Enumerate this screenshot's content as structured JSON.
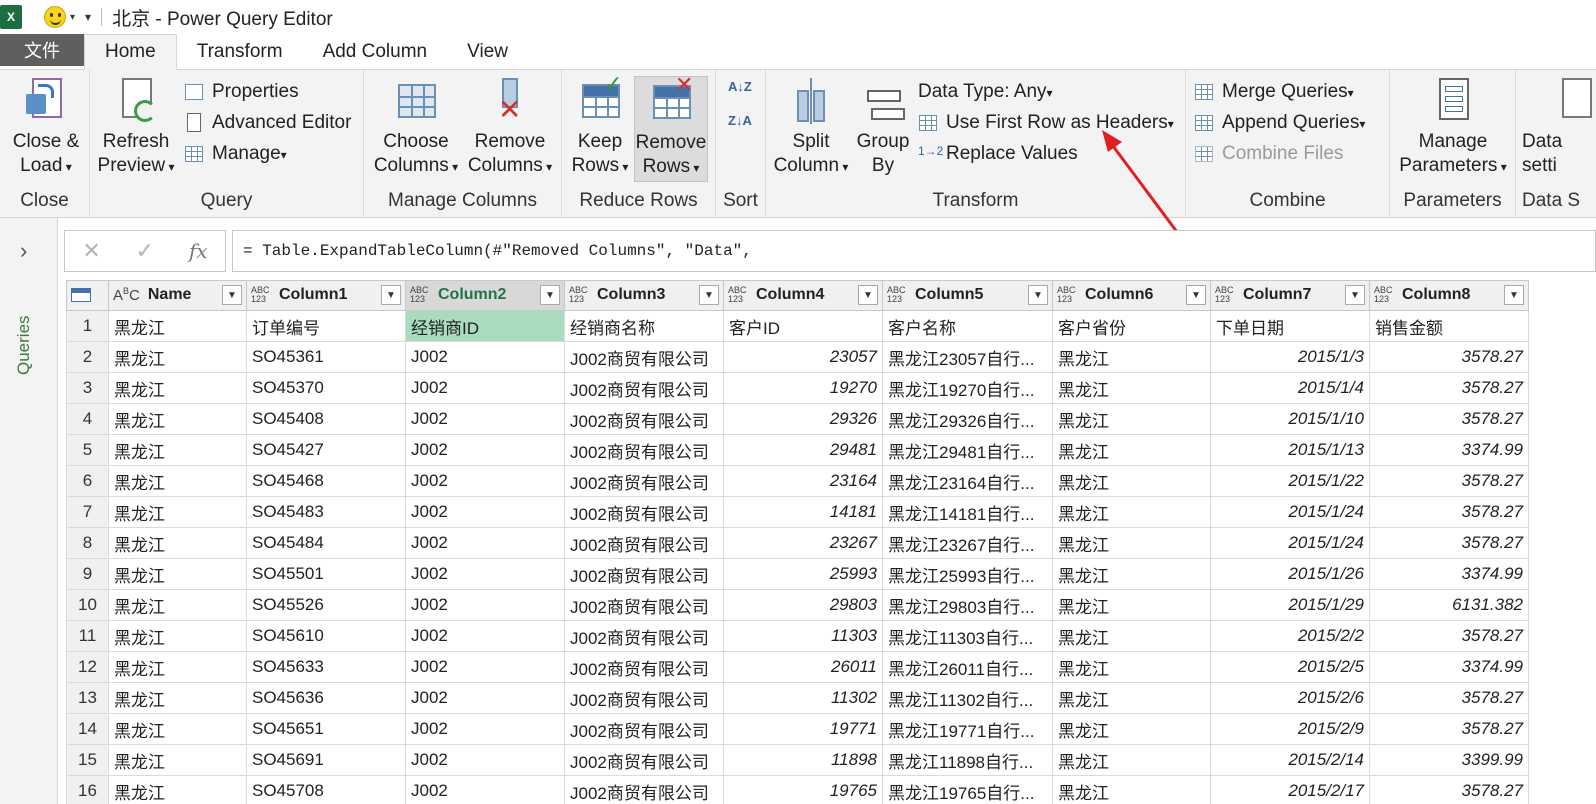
{
  "window": {
    "title": "北京 - Power Query Editor",
    "app_icon": "X"
  },
  "tabs": {
    "file": "文件",
    "items": [
      "Home",
      "Transform",
      "Add Column",
      "View"
    ],
    "active": "Home"
  },
  "ribbon": {
    "close": {
      "close_load_line1": "Close &",
      "close_load_line2": "Load",
      "label": "Close"
    },
    "query": {
      "refresh_line1": "Refresh",
      "refresh_line2": "Preview",
      "properties": "Properties",
      "advanced_editor": "Advanced Editor",
      "manage": "Manage",
      "label": "Query"
    },
    "manage_columns": {
      "choose_line1": "Choose",
      "choose_line2": "Columns",
      "remove_line1": "Remove",
      "remove_line2": "Columns",
      "label": "Manage Columns"
    },
    "reduce_rows": {
      "keep_line1": "Keep",
      "keep_line2": "Rows",
      "remove_line1": "Remove",
      "remove_line2": "Rows",
      "label": "Reduce Rows"
    },
    "sort": {
      "asc": "A↓Z",
      "desc": "Z↓A",
      "label": "Sort"
    },
    "transform": {
      "split_line1": "Split",
      "split_line2": "Column",
      "group_line1": "Group",
      "group_line2": "By",
      "data_type": "Data Type: Any",
      "first_row": "Use First Row as Headers",
      "replace": "Replace Values",
      "label": "Transform"
    },
    "combine": {
      "merge": "Merge Queries",
      "append": "Append Queries",
      "combine_files": "Combine Files",
      "label": "Combine"
    },
    "parameters": {
      "manage_line1": "Manage",
      "manage_line2": "Parameters",
      "label": "Parameters"
    },
    "data_source": {
      "line1": "Data",
      "line2": "setti",
      "label": "Data S"
    }
  },
  "sidebar": {
    "label": "Queries"
  },
  "formula_bar": {
    "cancel": "✕",
    "commit": "✓",
    "fx": "fx",
    "formula": "= Table.ExpandTableColumn(#\"Removed Columns\", \"Data\","
  },
  "grid": {
    "columns": [
      {
        "name": "Name",
        "type": "ABC"
      },
      {
        "name": "Column1",
        "type": "ABC123"
      },
      {
        "name": "Column2",
        "type": "ABC123"
      },
      {
        "name": "Column3",
        "type": "ABC123"
      },
      {
        "name": "Column4",
        "type": "ABC123"
      },
      {
        "name": "Column5",
        "type": "ABC123"
      },
      {
        "name": "Column6",
        "type": "ABC123"
      },
      {
        "name": "Column7",
        "type": "ABC123"
      },
      {
        "name": "Column8",
        "type": "ABC123"
      }
    ],
    "rows": [
      [
        "1",
        "黑龙江",
        "订单编号",
        "经销商ID",
        "经销商名称",
        "客户ID",
        "客户名称",
        "客户省份",
        "下单日期",
        "销售金额"
      ],
      [
        "2",
        "黑龙江",
        "SO45361",
        "J002",
        "J002商贸有限公司",
        "23057",
        "黑龙江23057自行...",
        "黑龙江",
        "2015/1/3",
        "3578.27"
      ],
      [
        "3",
        "黑龙江",
        "SO45370",
        "J002",
        "J002商贸有限公司",
        "19270",
        "黑龙江19270自行...",
        "黑龙江",
        "2015/1/4",
        "3578.27"
      ],
      [
        "4",
        "黑龙江",
        "SO45408",
        "J002",
        "J002商贸有限公司",
        "29326",
        "黑龙江29326自行...",
        "黑龙江",
        "2015/1/10",
        "3578.27"
      ],
      [
        "5",
        "黑龙江",
        "SO45427",
        "J002",
        "J002商贸有限公司",
        "29481",
        "黑龙江29481自行...",
        "黑龙江",
        "2015/1/13",
        "3374.99"
      ],
      [
        "6",
        "黑龙江",
        "SO45468",
        "J002",
        "J002商贸有限公司",
        "23164",
        "黑龙江23164自行...",
        "黑龙江",
        "2015/1/22",
        "3578.27"
      ],
      [
        "7",
        "黑龙江",
        "SO45483",
        "J002",
        "J002商贸有限公司",
        "14181",
        "黑龙江14181自行...",
        "黑龙江",
        "2015/1/24",
        "3578.27"
      ],
      [
        "8",
        "黑龙江",
        "SO45484",
        "J002",
        "J002商贸有限公司",
        "23267",
        "黑龙江23267自行...",
        "黑龙江",
        "2015/1/24",
        "3578.27"
      ],
      [
        "9",
        "黑龙江",
        "SO45501",
        "J002",
        "J002商贸有限公司",
        "25993",
        "黑龙江25993自行...",
        "黑龙江",
        "2015/1/26",
        "3374.99"
      ],
      [
        "10",
        "黑龙江",
        "SO45526",
        "J002",
        "J002商贸有限公司",
        "29803",
        "黑龙江29803自行...",
        "黑龙江",
        "2015/1/29",
        "6131.382"
      ],
      [
        "11",
        "黑龙江",
        "SO45610",
        "J002",
        "J002商贸有限公司",
        "11303",
        "黑龙江11303自行...",
        "黑龙江",
        "2015/2/2",
        "3578.27"
      ],
      [
        "12",
        "黑龙江",
        "SO45633",
        "J002",
        "J002商贸有限公司",
        "26011",
        "黑龙江26011自行...",
        "黑龙江",
        "2015/2/5",
        "3374.99"
      ],
      [
        "13",
        "黑龙江",
        "SO45636",
        "J002",
        "J002商贸有限公司",
        "11302",
        "黑龙江11302自行...",
        "黑龙江",
        "2015/2/6",
        "3578.27"
      ],
      [
        "14",
        "黑龙江",
        "SO45651",
        "J002",
        "J002商贸有限公司",
        "19771",
        "黑龙江19771自行...",
        "黑龙江",
        "2015/2/9",
        "3578.27"
      ],
      [
        "15",
        "黑龙江",
        "SO45691",
        "J002",
        "J002商贸有限公司",
        "11898",
        "黑龙江11898自行...",
        "黑龙江",
        "2015/2/14",
        "3399.99"
      ],
      [
        "16",
        "黑龙江",
        "SO45708",
        "J002",
        "J002商贸有限公司",
        "19765",
        "黑龙江19765自行...",
        "黑龙江",
        "2015/2/17",
        "3578.27"
      ]
    ]
  },
  "colors": {
    "accent_green": "#217346",
    "selected_cell": "#a9dcbf",
    "arrow_red": "#e02020"
  }
}
